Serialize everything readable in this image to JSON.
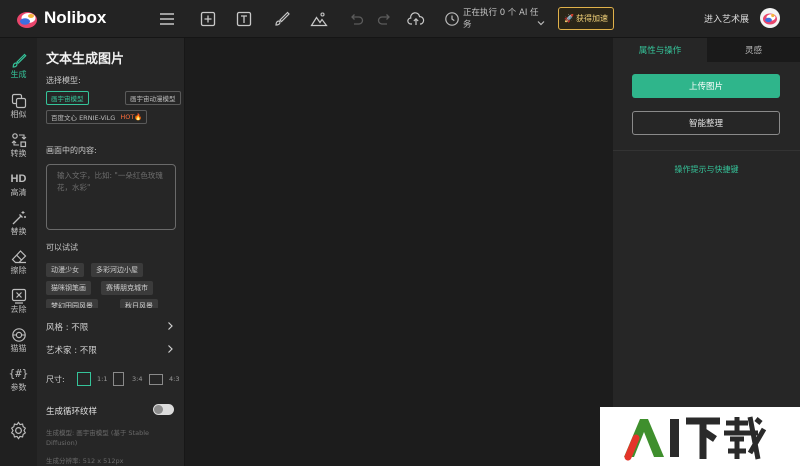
{
  "app": {
    "brand": "Nolibox"
  },
  "topbar": {
    "task_status": "正在执行 0 个 AI 任务",
    "speed_label": "获得加速",
    "enter_gallery": "进入艺术展",
    "icons": [
      "menu-icon",
      "add-frame-icon",
      "text-icon",
      "brush-icon",
      "image-icon",
      "undo-icon",
      "redo-icon",
      "cloud-upload-icon",
      "clock-icon",
      "rocket-icon"
    ]
  },
  "rail": {
    "items": [
      {
        "label": "生成",
        "icon": "brush-icon",
        "active": true
      },
      {
        "label": "相似",
        "icon": "copy-icon"
      },
      {
        "label": "转换",
        "icon": "transform-icon"
      },
      {
        "label": "高清",
        "icon": "hd-icon",
        "glyph": "HD"
      },
      {
        "label": "替换",
        "icon": "magic-wand-icon"
      },
      {
        "label": "擦除",
        "icon": "eraser-icon"
      },
      {
        "label": "去除",
        "icon": "remove-icon"
      },
      {
        "label": "猫猫",
        "icon": "cat-icon"
      },
      {
        "label": "参数",
        "icon": "params-icon",
        "glyph": "{#}"
      }
    ]
  },
  "panel": {
    "title": "文本生成图片",
    "model_label": "选择模型:",
    "models": [
      {
        "name": "画宇宙模型",
        "selected": true
      },
      {
        "name": "画宇宙动漫模型",
        "selected": false
      },
      {
        "name": "百度文心 ERNIE-ViLG",
        "badge": "HOT🔥",
        "selected": false
      }
    ],
    "content_label": "画面中的内容:",
    "prompt_placeholder": "输入文字，比如: \"一朵红色玫瑰花，水彩\"",
    "try_label": "可以试试",
    "try_tags": [
      "动漫少女",
      "多彩河边小屋",
      "猫咪钢笔画",
      "赛博朋克城市",
      "梦幻田园风景",
      "秋日风景"
    ],
    "style_row": "风格 : 不限",
    "artist_row": "艺术家 : 不限",
    "size_label": "尺寸:",
    "ratios": [
      "1:1",
      "3:4",
      "4:3"
    ],
    "selected_ratio": "1:1",
    "loop_texture_label": "生成循环纹样",
    "loop_texture_on": false,
    "info_model": "生成模型: 画宇宙模型 (基于 Stable Diffusion)",
    "info_resolution": "生成分辨率: 512 x 512px"
  },
  "right": {
    "tab_props": "属性与操作",
    "tab_inspiration": "灵感",
    "upload_btn": "上传图片",
    "smart_btn": "智能整理",
    "tips_link": "操作提示与快捷键"
  },
  "watermark": {
    "text": "AI下载"
  },
  "colors": {
    "accent": "#35c49a",
    "gold": "#e0b14a",
    "bg": "#1c1c1c",
    "panel": "#262626"
  }
}
